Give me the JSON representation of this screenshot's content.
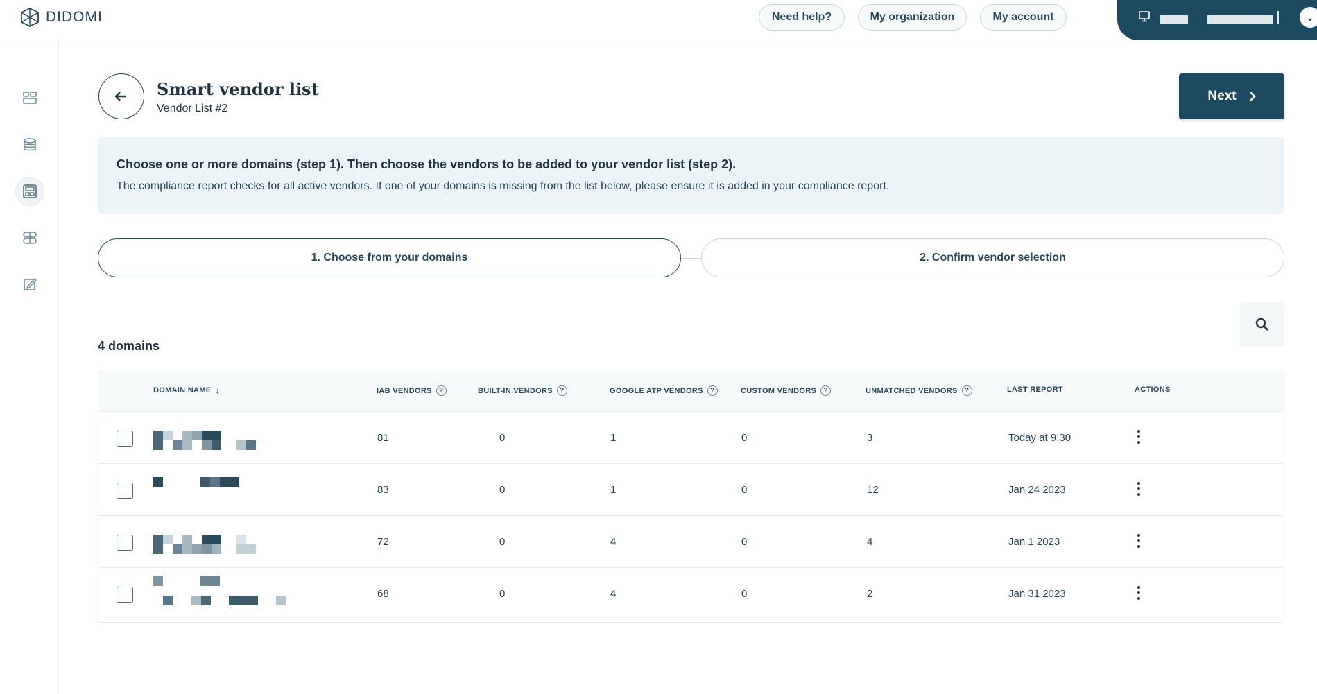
{
  "topbar": {
    "logo_text": "DIDOMI",
    "help_label": "Need help?",
    "organization_label": "My organization",
    "account_label": "My account"
  },
  "header": {
    "title": "Smart vendor list",
    "subtitle": "Vendor List #2",
    "next_label": "Next"
  },
  "info": {
    "title": "Choose one or more domains (step 1). Then choose the vendors to be added to your vendor list (step 2).",
    "text": "The compliance report checks for all active vendors. If one of your domains is missing from the list below, please ensure it is added in your compliance report."
  },
  "steps": {
    "step1": "1. Choose from your domains",
    "step2": "2. Confirm vendor selection"
  },
  "domain_count": "4 domains",
  "table": {
    "headers": {
      "domain_name": "DOMAIN NAME",
      "iab": "IAB VENDORS",
      "builtin": "BUILT-IN VENDORS",
      "google": "GOOGLE ATP VENDORS",
      "custom": "CUSTOM VENDORS",
      "unmatched": "UNMATCHED VENDORS",
      "last_report": "LAST REPORT",
      "actions": "ACTIONS",
      "help_glyph": "?"
    },
    "rows": [
      {
        "iab": "81",
        "builtin": "0",
        "google": "1",
        "custom": "0",
        "unmatched": "3",
        "last_report": "Today at 9:30"
      },
      {
        "iab": "83",
        "builtin": "0",
        "google": "1",
        "custom": "0",
        "unmatched": "12",
        "last_report": "Jan 24 2023"
      },
      {
        "iab": "72",
        "builtin": "0",
        "google": "4",
        "custom": "0",
        "unmatched": "4",
        "last_report": "Jan 1 2023"
      },
      {
        "iab": "68",
        "builtin": "0",
        "google": "4",
        "custom": "0",
        "unmatched": "2",
        "last_report": "Jan 31 2023"
      }
    ]
  },
  "colors": {
    "primary": "#1d4a5f",
    "info_bg": "#edf4f7",
    "text": "#1f3340"
  }
}
